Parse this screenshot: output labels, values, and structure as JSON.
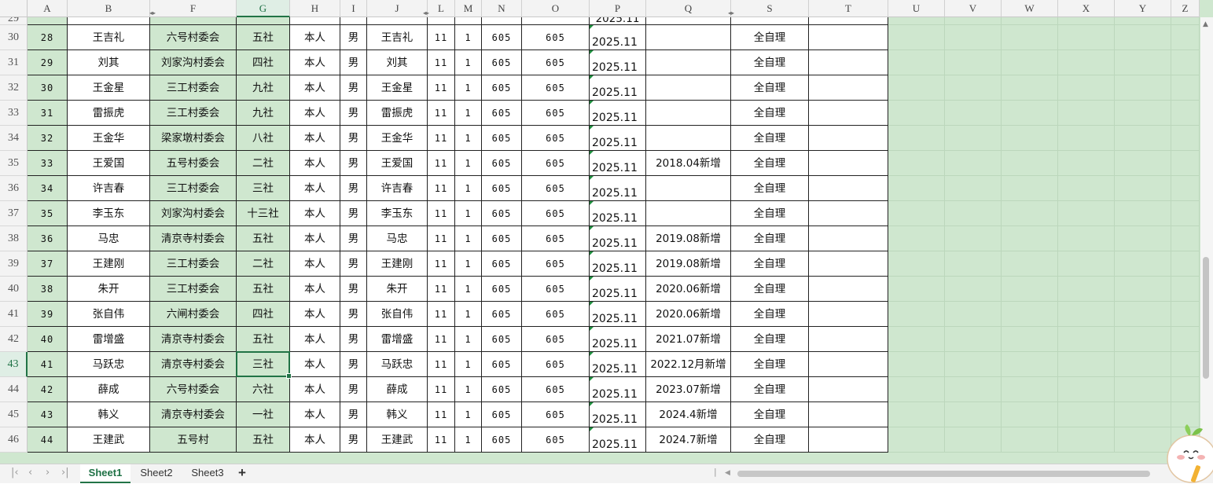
{
  "columns": [
    {
      "label": "A",
      "w": 51,
      "white": false
    },
    {
      "label": "B",
      "w": 105,
      "white": true
    },
    {
      "label": "F",
      "w": 110,
      "white": false
    },
    {
      "label": "G",
      "w": 68,
      "white": false
    },
    {
      "label": "H",
      "w": 64,
      "white": true
    },
    {
      "label": "I",
      "w": 34,
      "white": true
    },
    {
      "label": "J",
      "w": 77,
      "white": true
    },
    {
      "label": "L",
      "w": 35,
      "white": true
    },
    {
      "label": "M",
      "w": 34,
      "white": true
    },
    {
      "label": "N",
      "w": 51,
      "white": true
    },
    {
      "label": "O",
      "w": 86,
      "white": true
    },
    {
      "label": "P",
      "w": 72,
      "white": true
    },
    {
      "label": "Q",
      "w": 108,
      "white": true
    },
    {
      "label": "S",
      "w": 99,
      "white": true
    },
    {
      "label": "T",
      "w": 101,
      "white": true
    }
  ],
  "extra_columns": [
    {
      "label": "U",
      "w": 72
    },
    {
      "label": "V",
      "w": 72
    },
    {
      "label": "W",
      "w": 72
    },
    {
      "label": "X",
      "w": 72
    },
    {
      "label": "Y",
      "w": 72
    },
    {
      "label": "Z",
      "w": 36
    }
  ],
  "top_partial": {
    "row": "29",
    "cells": [
      "",
      "",
      "",
      "",
      "",
      "",
      "",
      "",
      "",
      "",
      "",
      "2025.11",
      "",
      "",
      ""
    ]
  },
  "rows": [
    {
      "row": "30",
      "cells": [
        "28",
        "王吉礼",
        "六号村委会",
        "五社",
        "本人",
        "男",
        "王吉礼",
        "11",
        "1",
        "605",
        "605",
        "2025.11",
        "",
        "全自理",
        ""
      ]
    },
    {
      "row": "31",
      "cells": [
        "29",
        "刘其",
        "刘家沟村委会",
        "四社",
        "本人",
        "男",
        "刘其",
        "11",
        "1",
        "605",
        "605",
        "2025.11",
        "",
        "全自理",
        ""
      ]
    },
    {
      "row": "32",
      "cells": [
        "30",
        "王金星",
        "三工村委会",
        "九社",
        "本人",
        "男",
        "王金星",
        "11",
        "1",
        "605",
        "605",
        "2025.11",
        "",
        "全自理",
        ""
      ]
    },
    {
      "row": "33",
      "cells": [
        "31",
        "雷振虎",
        "三工村委会",
        "九社",
        "本人",
        "男",
        "雷振虎",
        "11",
        "1",
        "605",
        "605",
        "2025.11",
        "",
        "全自理",
        ""
      ]
    },
    {
      "row": "34",
      "cells": [
        "32",
        "王金华",
        "梁家墩村委会",
        "八社",
        "本人",
        "男",
        "王金华",
        "11",
        "1",
        "605",
        "605",
        "2025.11",
        "",
        "全自理",
        ""
      ]
    },
    {
      "row": "35",
      "cells": [
        "33",
        "王爱国",
        "五号村委会",
        "二社",
        "本人",
        "男",
        "王爱国",
        "11",
        "1",
        "605",
        "605",
        "2025.11",
        "2018.04新增",
        "全自理",
        ""
      ]
    },
    {
      "row": "36",
      "cells": [
        "34",
        "许吉春",
        "三工村委会",
        "三社",
        "本人",
        "男",
        "许吉春",
        "11",
        "1",
        "605",
        "605",
        "2025.11",
        "",
        "全自理",
        ""
      ]
    },
    {
      "row": "37",
      "cells": [
        "35",
        "李玉东",
        "刘家沟村委会",
        "十三社",
        "本人",
        "男",
        "李玉东",
        "11",
        "1",
        "605",
        "605",
        "2025.11",
        "",
        "全自理",
        ""
      ]
    },
    {
      "row": "38",
      "cells": [
        "36",
        "马忠",
        "清京寺村委会",
        "五社",
        "本人",
        "男",
        "马忠",
        "11",
        "1",
        "605",
        "605",
        "2025.11",
        "2019.08新增",
        "全自理",
        ""
      ]
    },
    {
      "row": "39",
      "cells": [
        "37",
        "王建刚",
        "三工村委会",
        "二社",
        "本人",
        "男",
        "王建刚",
        "11",
        "1",
        "605",
        "605",
        "2025.11",
        "2019.08新增",
        "全自理",
        ""
      ]
    },
    {
      "row": "40",
      "cells": [
        "38",
        "朱开",
        "三工村委会",
        "五社",
        "本人",
        "男",
        "朱开",
        "11",
        "1",
        "605",
        "605",
        "2025.11",
        "2020.06新增",
        "全自理",
        ""
      ]
    },
    {
      "row": "41",
      "cells": [
        "39",
        "张自伟",
        "六闸村委会",
        "四社",
        "本人",
        "男",
        "张自伟",
        "11",
        "1",
        "605",
        "605",
        "2025.11",
        "2020.06新增",
        "全自理",
        ""
      ]
    },
    {
      "row": "42",
      "cells": [
        "40",
        "雷增盛",
        "清京寺村委会",
        "五社",
        "本人",
        "男",
        "雷增盛",
        "11",
        "1",
        "605",
        "605",
        "2025.11",
        "2021.07新增",
        "全自理",
        ""
      ]
    },
    {
      "row": "43",
      "cells": [
        "41",
        "马跃忠",
        "清京寺村委会",
        "三社",
        "本人",
        "男",
        "马跃忠",
        "11",
        "1",
        "605",
        "605",
        "2025.11",
        "2022.12月新增",
        "全自理",
        ""
      ]
    },
    {
      "row": "44",
      "cells": [
        "42",
        "薛成",
        "六号村委会",
        "六社",
        "本人",
        "男",
        "薛成",
        "11",
        "1",
        "605",
        "605",
        "2025.11",
        "2023.07新增",
        "全自理",
        ""
      ]
    },
    {
      "row": "45",
      "cells": [
        "43",
        "韩义",
        "清京寺村委会",
        "一社",
        "本人",
        "男",
        "韩义",
        "11",
        "1",
        "605",
        "605",
        "2025.11",
        "2024.4新增",
        "全自理",
        ""
      ]
    },
    {
      "row": "46",
      "cells": [
        "44",
        "王建武",
        "五号村",
        "五社",
        "本人",
        "男",
        "王建武",
        "11",
        "1",
        "605",
        "605",
        "2025.11",
        "2024.7新增",
        "全自理",
        ""
      ]
    }
  ],
  "selected": {
    "row": "43",
    "col": "G"
  },
  "sheets": [
    {
      "label": "Sheet1",
      "active": true
    },
    {
      "label": "Sheet2",
      "active": false
    },
    {
      "label": "Sheet3",
      "active": false
    }
  ],
  "add_sheet_label": "+",
  "colors": {
    "accent": "#217346",
    "sheet_bg": "#cfe7cf",
    "grid": "#222222"
  }
}
